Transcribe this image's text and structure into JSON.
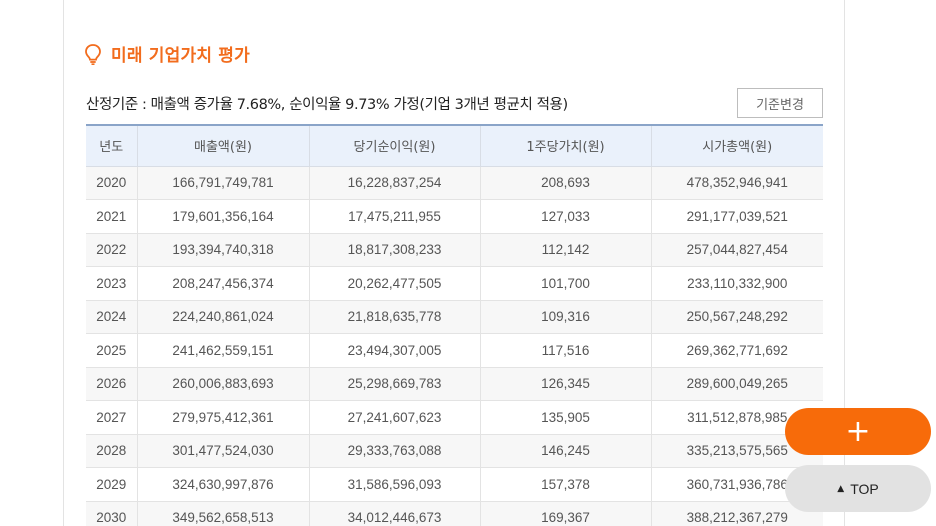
{
  "section": {
    "icon": "lightbulb-icon",
    "title": "미래 기업가치 평가",
    "accent_color": "#f26c1d"
  },
  "basis": {
    "text": "산정기준 : 매출액 증가율 7.68%, 순이익율 9.73% 가정(기업 3개년 평균치 적용)"
  },
  "change_button": {
    "label": "기준변경"
  },
  "table": {
    "headers": [
      "년도",
      "매출액(원)",
      "당기순이익(원)",
      "1주당가치(원)",
      "시가총액(원)"
    ],
    "rows": [
      [
        "2020",
        "166,791,749,781",
        "16,228,837,254",
        "208,693",
        "478,352,946,941"
      ],
      [
        "2021",
        "179,601,356,164",
        "17,475,211,955",
        "127,033",
        "291,177,039,521"
      ],
      [
        "2022",
        "193,394,740,318",
        "18,817,308,233",
        "112,142",
        "257,044,827,454"
      ],
      [
        "2023",
        "208,247,456,374",
        "20,262,477,505",
        "101,700",
        "233,110,332,900"
      ],
      [
        "2024",
        "224,240,861,024",
        "21,818,635,778",
        "109,316",
        "250,567,248,292"
      ],
      [
        "2025",
        "241,462,559,151",
        "23,494,307,005",
        "117,516",
        "269,362,771,692"
      ],
      [
        "2026",
        "260,006,883,693",
        "25,298,669,783",
        "126,345",
        "289,600,049,265"
      ],
      [
        "2027",
        "279,975,412,361",
        "27,241,607,623",
        "135,905",
        "311,512,878,985"
      ],
      [
        "2028",
        "301,477,524,030",
        "29,333,763,088",
        "146,245",
        "335,213,575,565"
      ],
      [
        "2029",
        "324,630,997,876",
        "31,586,596,093",
        "157,378",
        "360,731,936,786"
      ],
      [
        "2030",
        "349,562,658,513",
        "34,012,446,673",
        "169,367",
        "388,212,367,279"
      ]
    ]
  },
  "floating": {
    "plus_icon": "plus-icon",
    "plus_color": "#f76b0a",
    "top_icon": "triangle-up-icon",
    "top_label": "TOP"
  }
}
